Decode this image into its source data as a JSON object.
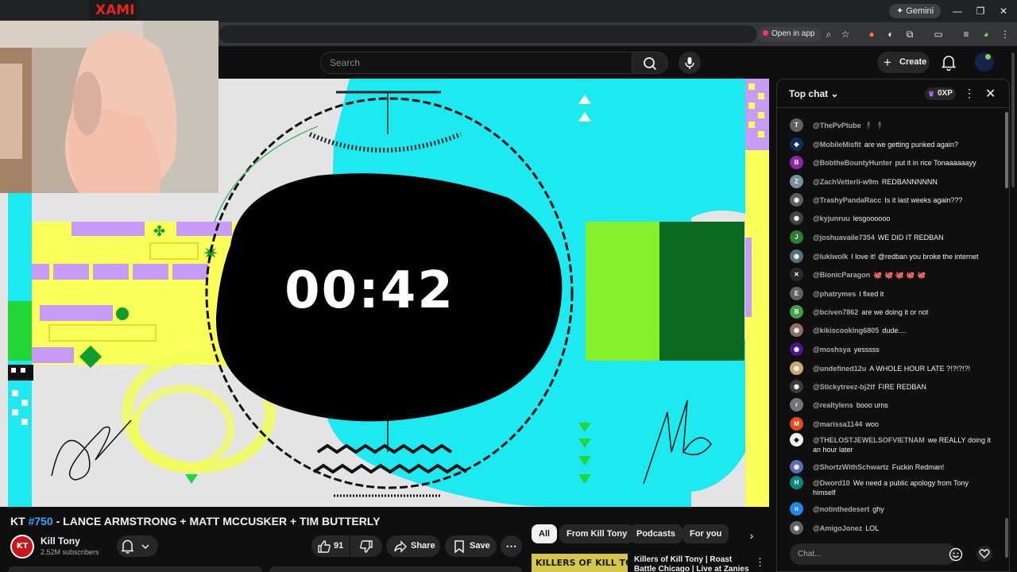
{
  "browser": {
    "gemini_label": "Gemini",
    "open_in_app_label": "Open in app",
    "window_controls": [
      "—",
      "❐",
      "✕"
    ]
  },
  "masthead": {
    "search_placeholder": "Search",
    "create_label": "Create",
    "plus_glyph": "+"
  },
  "webcam_banner_text": "XAMI",
  "player": {
    "countdown": "00:42"
  },
  "video": {
    "title_prefix": "KT ",
    "episode": "#750",
    "title_rest": " - LANCE ARMSTRONG + MATT MCCUSKER + TIM BUTTERLY",
    "channel_avatar_text": "KT",
    "channel_name": "Kill Tony",
    "subscribers": "2.52M subscribers",
    "like_count": "91",
    "share_label": "Share",
    "save_label": "Save",
    "more_glyph": "⋯",
    "bell_caret": "⌄"
  },
  "recommendations": {
    "chips": [
      "All",
      "From Kill Tony",
      "Podcasts",
      "For you"
    ],
    "chip_arrow": "›",
    "thumb_text": "KILLERS OF KILL TONY",
    "title": "Killers of Kill Tony | Roast Battle Chicago | Live at Zanies",
    "menu_glyph": "⋮"
  },
  "chat": {
    "header_label": "Top chat",
    "caret": "⌄",
    "xp_label": "0XP",
    "crown_glyph": "♛",
    "kebab_glyph": "⋮",
    "close_glyph": "✕",
    "input_placeholder": "Chat...",
    "messages": [
      {
        "author": "@ThePvPtube",
        "text": "🕴 🕴",
        "avatar": "T",
        "color": "#616161"
      },
      {
        "author": "@MobileMisfit",
        "text": "are we getting punked again?",
        "avatar": "◆",
        "color": "#0b2e5c"
      },
      {
        "author": "@BobtheBountyHunter",
        "text": "put it in rice Tonaaaaaayy",
        "avatar": "B",
        "color": "#8e24aa"
      },
      {
        "author": "@ZachVetterli-w9m",
        "text": "REDBANNNNNN",
        "avatar": "Z",
        "color": "#78909c"
      },
      {
        "author": "@TrashyPandaRacc",
        "text": "Is it last weeks again???",
        "avatar": "◉",
        "color": "#5d5d5d"
      },
      {
        "author": "@kyjunruu",
        "text": "lesgoooooo",
        "avatar": "◉",
        "color": "#444444"
      },
      {
        "author": "@joshuavaile7354",
        "text": "WE DID IT REDBAN",
        "avatar": "J",
        "color": "#2e7d32"
      },
      {
        "author": "@lukiwolk",
        "text": "I love it! @redban you broke the internet",
        "avatar": "◉",
        "color": "#546e7a"
      },
      {
        "author": "@BionicParagon",
        "text": "🐙 🐙 🐙 🐙 🐙",
        "avatar": "✕",
        "color": "#2a2a2a"
      },
      {
        "author": "@phatrymes",
        "text": "I fixed it",
        "avatar": "E",
        "color": "#5f6368"
      },
      {
        "author": "@bciven7862",
        "text": "are we doing it or not",
        "avatar": "B",
        "color": "#43a047"
      },
      {
        "author": "@kikiscooking6805",
        "text": "dude....",
        "avatar": "◉",
        "color": "#8d6e63"
      },
      {
        "author": "@moshsya",
        "text": "yesssss",
        "avatar": "◉",
        "color": "#4a148c"
      },
      {
        "author": "@undefined12u",
        "text": "A WHOLE HOUR LATE ?!?!?!?!",
        "avatar": "◉",
        "color": "#c9a86a"
      },
      {
        "author": "@Stickytreez-bj2tf",
        "text": "FIRE REDBAN",
        "avatar": "◉",
        "color": "#3a3a3a"
      },
      {
        "author": "@realtylens",
        "text": "booo urns",
        "avatar": "r",
        "color": "#757575"
      },
      {
        "author": "@marissa1144",
        "text": "woo",
        "avatar": "M",
        "color": "#e64a19"
      },
      {
        "author": "@THELOSTJEWELSOFVIETNAM",
        "text": "we REALLY doing it an hour later",
        "avatar": "◆",
        "color": "#f1f1f1"
      },
      {
        "author": "@ShortzWithSchwartz",
        "text": "Fuckin Redman!",
        "avatar": "◉",
        "color": "#5c6bc0"
      },
      {
        "author": "@Dword10",
        "text": "We need a public apology from Tony himself",
        "avatar": "H",
        "color": "#00897b"
      },
      {
        "author": "@notinthedesert",
        "text": "ghy",
        "avatar": "n",
        "color": "#1e88e5"
      },
      {
        "author": "@AmigoJonez",
        "text": "LOL",
        "avatar": "◉",
        "color": "#616161"
      }
    ]
  },
  "colors": {
    "accent_link": "#3ea6ff",
    "video_cyan": "#1de9f0",
    "video_yellow": "#fbff5a",
    "video_purple": "#c79bf7",
    "video_green": "#0e9e2c"
  }
}
